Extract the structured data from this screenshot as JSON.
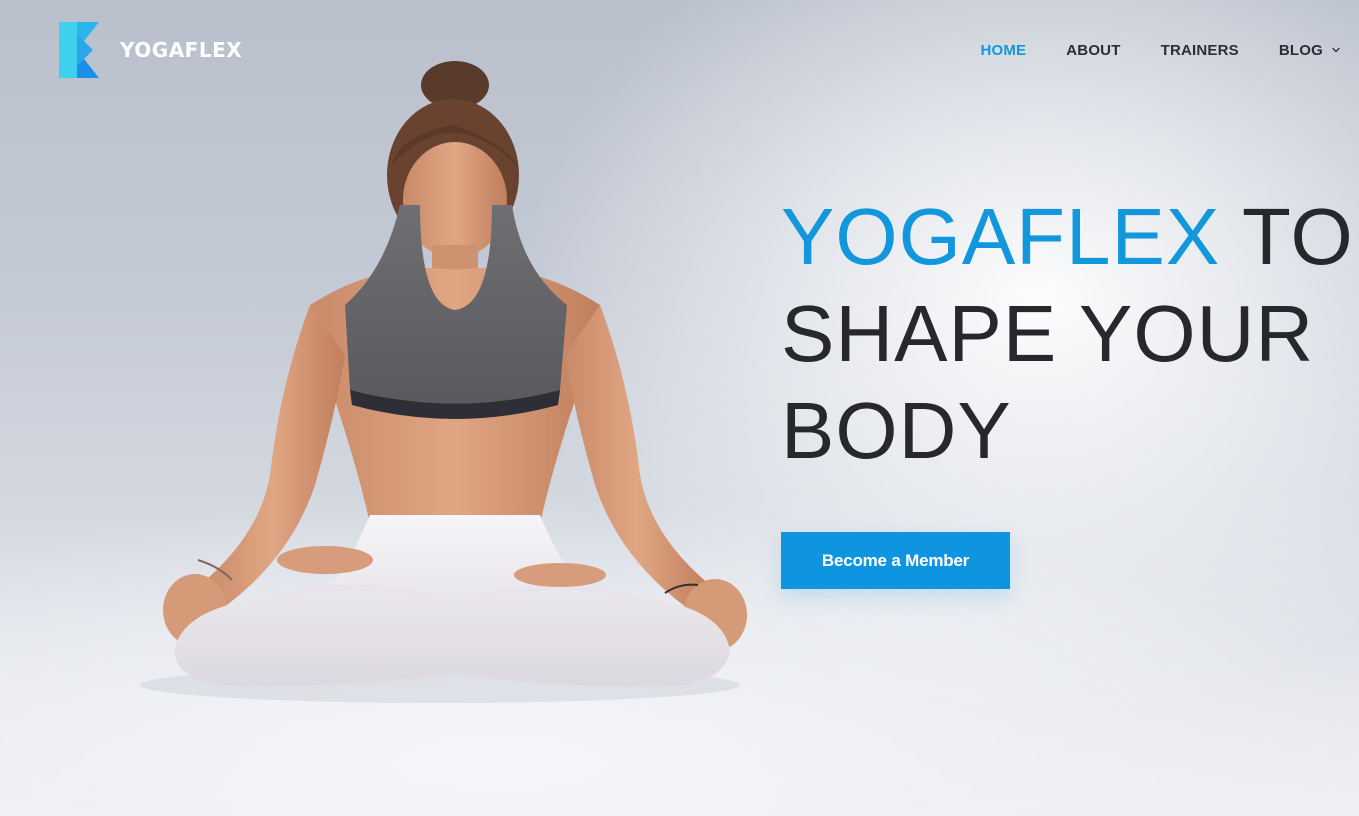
{
  "brand": {
    "name": "YOGAFLEX",
    "logo_icon": "yogaflex-k-logo-icon",
    "colors": {
      "accent": "#1296dc",
      "logo_light": "#3fd0ee",
      "logo_dark": "#1e8fe6"
    }
  },
  "nav": {
    "items": [
      {
        "label": "HOME",
        "active": true
      },
      {
        "label": "ABOUT",
        "active": false
      },
      {
        "label": "TRAINERS",
        "active": false
      },
      {
        "label": "BLOG",
        "active": false,
        "icon": "chevron-down-icon"
      }
    ]
  },
  "hero": {
    "headline_accent": "YOGAFLEX",
    "headline_rest_1": " TO",
    "headline_line_2": "SHAPE YOUR",
    "headline_line_3": "BODY",
    "cta_label": "Become a Member",
    "image_subject": "woman-meditating-lotus-pose-image"
  }
}
